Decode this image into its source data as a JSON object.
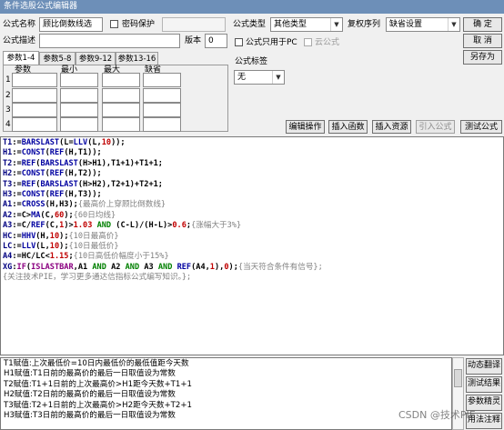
{
  "window": {
    "title": "条件选股公式编辑器"
  },
  "form": {
    "name_label": "公式名称",
    "name_value": "顾比倒数线选",
    "password_label": "密码保护",
    "password_value": "",
    "desc_label": "公式描述",
    "desc_value": "",
    "version_label": "版本",
    "version_value": "0",
    "type_label": "公式类型",
    "type_value": "其他类型",
    "fuquan_label": "复权序列",
    "fuquan_value": "缺省设置",
    "pc_only_label": "公式只用于PC",
    "cloud_label": "云公式",
    "tag_label": "公式标签",
    "tag_value": "无"
  },
  "buttons": {
    "ok": "确 定",
    "cancel": "取 消",
    "save_as": "另存为",
    "edit_ops": "编辑操作",
    "insert_func": "插入函数",
    "insert_resource": "插入资源",
    "import_formula": "引入公式",
    "test_formula": "测试公式"
  },
  "tabs": [
    "参数1-4",
    "参数5-8",
    "参数9-12",
    "参数13-16"
  ],
  "params": {
    "headers": [
      "参数",
      "最小",
      "最大",
      "缺省"
    ],
    "rows": [
      "1",
      "2",
      "3",
      "4"
    ]
  },
  "code_lines": [
    [
      [
        "k",
        "T1"
      ],
      [
        "b",
        ":="
      ],
      [
        "f",
        "BARSLAST"
      ],
      [
        "b",
        "(L="
      ],
      [
        "f",
        "LLV"
      ],
      [
        "b",
        "(L,"
      ],
      [
        "n",
        "10"
      ],
      [
        "b",
        "));"
      ]
    ],
    [
      [
        "k",
        "H1"
      ],
      [
        "b",
        ":="
      ],
      [
        "f",
        "CONST"
      ],
      [
        "b",
        "("
      ],
      [
        "f",
        "REF"
      ],
      [
        "b",
        "(H,T1));"
      ]
    ],
    [
      [
        "k",
        "T2"
      ],
      [
        "b",
        ":="
      ],
      [
        "f",
        "REF"
      ],
      [
        "b",
        "("
      ],
      [
        "f",
        "BARSLAST"
      ],
      [
        "b",
        "(H>H1),T1+1)+T1+1;"
      ]
    ],
    [
      [
        "k",
        "H2"
      ],
      [
        "b",
        ":="
      ],
      [
        "f",
        "CONST"
      ],
      [
        "b",
        "("
      ],
      [
        "f",
        "REF"
      ],
      [
        "b",
        "(H,T2));"
      ]
    ],
    [
      [
        "k",
        "T3"
      ],
      [
        "b",
        ":="
      ],
      [
        "f",
        "REF"
      ],
      [
        "b",
        "("
      ],
      [
        "f",
        "BARSLAST"
      ],
      [
        "b",
        "(H>H2),T2+1)+T2+1;"
      ]
    ],
    [
      [
        "k",
        "H3"
      ],
      [
        "b",
        ":="
      ],
      [
        "f",
        "CONST"
      ],
      [
        "b",
        "("
      ],
      [
        "f",
        "REF"
      ],
      [
        "b",
        "(H,T3));"
      ]
    ],
    [
      [
        "k",
        "A1"
      ],
      [
        "b",
        ":="
      ],
      [
        "f",
        "CROSS"
      ],
      [
        "b",
        "(H,H3);"
      ],
      [
        "c",
        "{最高价上穿顾比倒数线}"
      ]
    ],
    [
      [
        "k",
        "A2"
      ],
      [
        "b",
        ":=C>"
      ],
      [
        "f",
        "MA"
      ],
      [
        "b",
        "(C,"
      ],
      [
        "n",
        "60"
      ],
      [
        "b",
        ");"
      ],
      [
        "c",
        "{60日均线}"
      ]
    ],
    [
      [
        "k",
        "A3"
      ],
      [
        "b",
        ":=C/"
      ],
      [
        "f",
        "REF"
      ],
      [
        "b",
        "(C,"
      ],
      [
        "n",
        "1"
      ],
      [
        "b",
        ")>"
      ],
      [
        "n",
        "1.03"
      ],
      [
        "b",
        " "
      ],
      [
        "g",
        "AND"
      ],
      [
        "b",
        " (C-L)/(H-L)>"
      ],
      [
        "n",
        "0.6"
      ],
      [
        "b",
        ";"
      ],
      [
        "c",
        "{涨幅大于3%}"
      ]
    ],
    [
      [
        "k",
        "HC"
      ],
      [
        "b",
        ":="
      ],
      [
        "f",
        "HHV"
      ],
      [
        "b",
        "(H,"
      ],
      [
        "n",
        "10"
      ],
      [
        "b",
        ");"
      ],
      [
        "c",
        "{10日最高价}"
      ]
    ],
    [
      [
        "k",
        "LC"
      ],
      [
        "b",
        ":="
      ],
      [
        "f",
        "LLV"
      ],
      [
        "b",
        "(L,"
      ],
      [
        "n",
        "10"
      ],
      [
        "b",
        ");"
      ],
      [
        "c",
        "{10日最低价}"
      ]
    ],
    [
      [
        "k",
        "A4"
      ],
      [
        "b",
        ":=HC/LC<"
      ],
      [
        "n",
        "1.15"
      ],
      [
        "b",
        ";"
      ],
      [
        "c",
        "{10日高低价幅度小于15%}"
      ]
    ],
    [
      [
        "k",
        "XG"
      ],
      [
        "b",
        ":"
      ],
      [
        "m",
        "IF"
      ],
      [
        "b",
        "("
      ],
      [
        "m",
        "ISLASTBAR"
      ],
      [
        "b",
        ",A1 "
      ],
      [
        "g",
        "AND"
      ],
      [
        "b",
        " A2 "
      ],
      [
        "g",
        "AND"
      ],
      [
        "b",
        " A3 "
      ],
      [
        "g",
        "AND"
      ],
      [
        "b",
        " "
      ],
      [
        "f",
        "REF"
      ],
      [
        "b",
        "(A4,"
      ],
      [
        "n",
        "1"
      ],
      [
        "b",
        "),"
      ],
      [
        "n",
        "0"
      ],
      [
        "b",
        ");"
      ],
      [
        "c",
        "{当天符合条件有信号};"
      ]
    ],
    [
      [
        "c",
        "{关注技术PIE，学习更多通达信指标公式编写知识。};"
      ]
    ]
  ],
  "notes": [
    "T1赋值:上次最低价=10日内最低价的最低值距今天数",
    "H1赋值:T1日前的最高价的最后一日取值设为常数",
    "T2赋值:T1+1日前的上次最高价>H1距今天数+T1+1",
    "H2赋值:T2日前的最高价的最后一日取值设为常数",
    "T3赋值:T2+1日前的上次最高价>H2距今天数+T2+1",
    "H3赋值:T3日前的最高价的最后一日取值设为常数"
  ],
  "side_buttons": [
    "动态翻译",
    "测试结果",
    "参数精灵",
    "用法注释"
  ],
  "watermark": "CSDN @技术PIE"
}
